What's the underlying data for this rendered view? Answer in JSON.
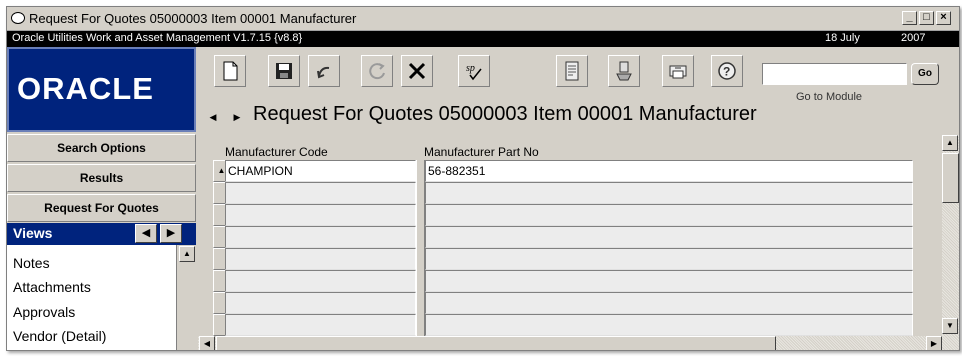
{
  "window": {
    "title": "Request For Quotes 05000003 Item 00001 Manufacturer",
    "controls": {
      "minimize": "_",
      "maximize": "□",
      "close": "×"
    }
  },
  "infobar": {
    "app_version": "Oracle Utilities Work and Asset Management V1.7.15 {v8.8}",
    "date_day": "18 July",
    "date_year": "2007"
  },
  "logo": {
    "text": "ORACLE"
  },
  "toolbar": {
    "buttons": [
      {
        "name": "new-icon"
      },
      {
        "name": "save-icon"
      },
      {
        "name": "undo-icon"
      },
      {
        "name": "refresh-icon"
      },
      {
        "name": "delete-icon"
      },
      {
        "name": "spell-check-icon",
        "label": "sp"
      },
      {
        "name": "report-icon"
      },
      {
        "name": "routing-icon"
      },
      {
        "name": "print-icon"
      },
      {
        "name": "help-icon",
        "label": "?"
      }
    ],
    "go_to_module": {
      "value": "",
      "button_label": "Go",
      "caption": "Go to Module"
    }
  },
  "page": {
    "title": "Request For Quotes 05000003 Item 00001 Manufacturer"
  },
  "nav": {
    "buttons": [
      "Search Options",
      "Results",
      "Request For Quotes"
    ],
    "views_label": "Views",
    "views_items": [
      "Notes",
      "Attachments",
      "Approvals",
      "Vendor (Detail)"
    ]
  },
  "grid": {
    "columns": [
      "Manufacturer Code",
      "Manufacturer Part No"
    ],
    "rows": [
      [
        "CHAMPION",
        "56-882351"
      ],
      [
        "",
        ""
      ],
      [
        "",
        ""
      ],
      [
        "",
        ""
      ],
      [
        "",
        ""
      ],
      [
        "",
        ""
      ],
      [
        "",
        ""
      ],
      [
        "",
        ""
      ]
    ]
  }
}
